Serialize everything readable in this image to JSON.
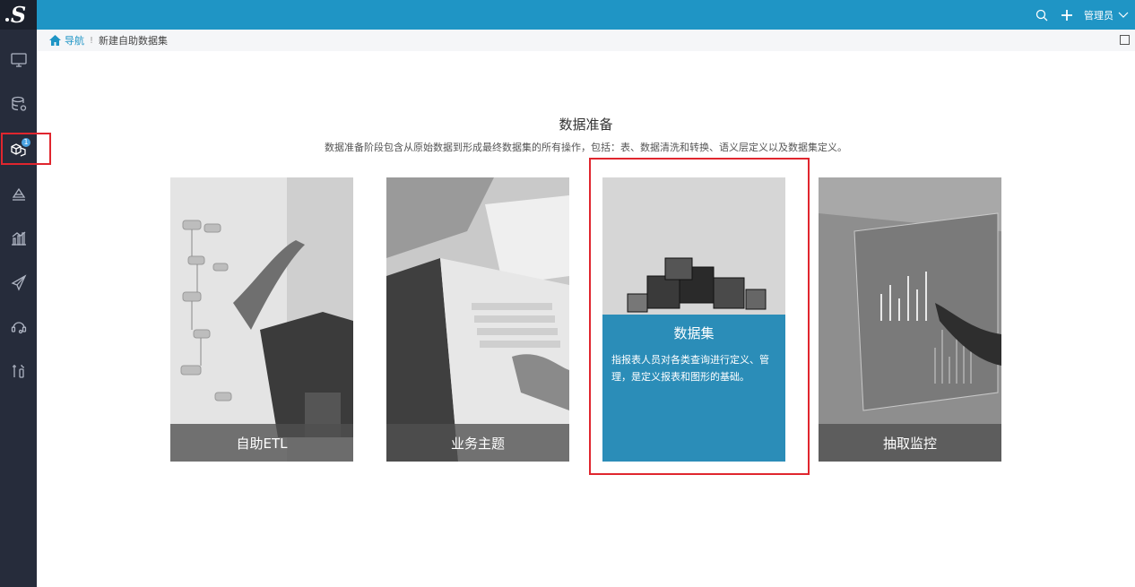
{
  "logo": {
    "letter": "S"
  },
  "sidebar": {
    "items": [
      {
        "icon": "monitor-icon"
      },
      {
        "icon": "database-icon"
      },
      {
        "icon": "cube-icon",
        "badge": "1"
      },
      {
        "icon": "layers-icon"
      },
      {
        "icon": "bar-chart-icon"
      },
      {
        "icon": "send-icon"
      },
      {
        "icon": "support-icon"
      },
      {
        "icon": "tools-icon"
      }
    ]
  },
  "topbar": {
    "user": "管理员"
  },
  "breadcrumb": {
    "home": "导航",
    "separator": "!",
    "current": "新建自助数据集"
  },
  "main": {
    "title": "数据准备",
    "subtitle": "数据准备阶段包含从原始数据到形成最终数据集的所有操作，包括：表、数据清洗和转换、语义层定义以及数据集定义。",
    "cards": [
      {
        "label": "自助ETL"
      },
      {
        "label": "业务主题"
      },
      {
        "label": "数据集",
        "description": "指报表人员对各类查询进行定义、管理，是定义报表和图形的基础。"
      },
      {
        "label": "抽取监控"
      }
    ]
  },
  "colors": {
    "topbar": "#1f95c5",
    "sidebar": "#262c3b",
    "highlight": "#e0262e",
    "overlay": "#2b8db8"
  }
}
